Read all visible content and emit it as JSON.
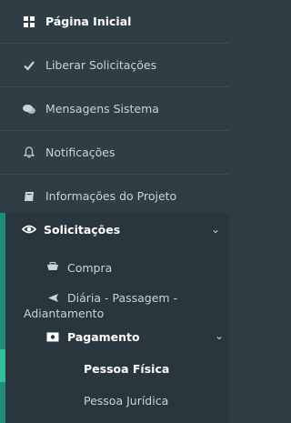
{
  "menu": {
    "items": [
      {
        "label": "Página Inicial",
        "icon": "grid-icon"
      },
      {
        "label": "Liberar Solicitações",
        "icon": "check-icon"
      },
      {
        "label": "Mensagens Sistema",
        "icon": "chat-icon"
      },
      {
        "label": "Notificações",
        "icon": "bell-icon"
      },
      {
        "label": "Informações do Projeto",
        "icon": "book-icon"
      }
    ],
    "solicitacoes": {
      "label": "Solicitações",
      "icon": "eye-icon",
      "children": [
        {
          "label": "Compra",
          "icon": "cart-icon"
        },
        {
          "label_line1": "Diária - Passagem -",
          "label_line2": "Adiantamento",
          "icon": "plane-icon"
        },
        {
          "label": "Pagamento",
          "icon": "money-icon",
          "children": [
            {
              "label": "Pessoa Física"
            },
            {
              "label": "Pessoa Jurídica"
            }
          ]
        }
      ]
    }
  },
  "colors": {
    "background": "#2f3d45",
    "submenu_background": "#2a363d",
    "accent": "#1e8c78",
    "highlight": "#2fc29a",
    "text": "#c9d3d8"
  }
}
